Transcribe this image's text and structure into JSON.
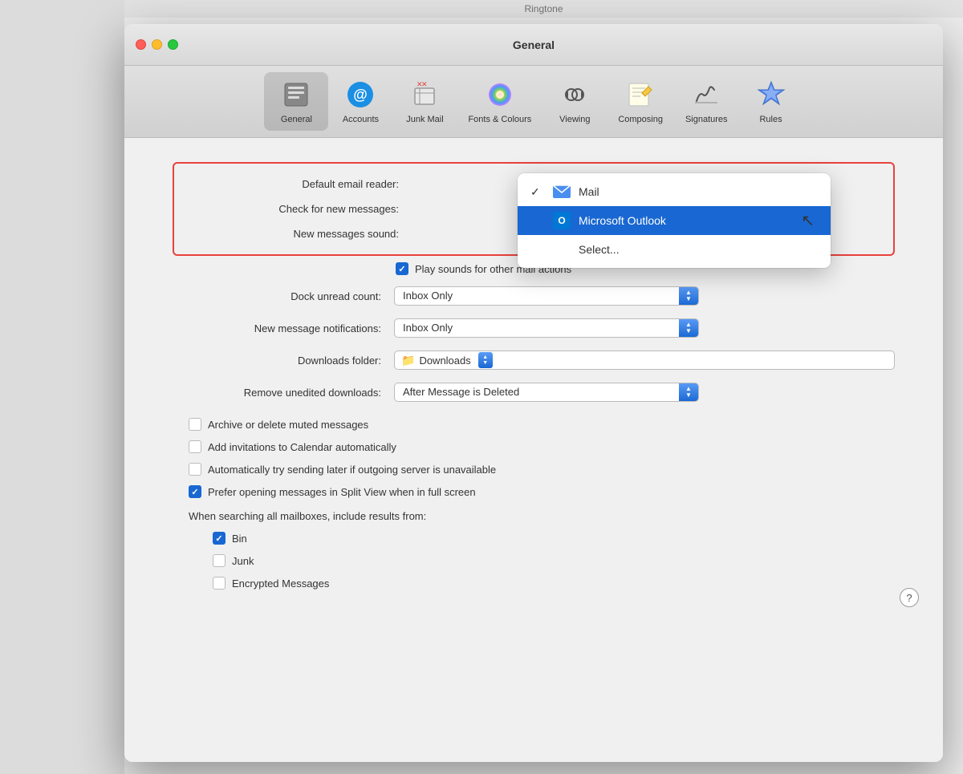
{
  "window": {
    "ringtone_label": "Ringtone",
    "title": "General",
    "traffic_lights": [
      "close",
      "minimize",
      "zoom"
    ]
  },
  "toolbar": {
    "items": [
      {
        "id": "general",
        "label": "General",
        "icon": "⊟",
        "active": true
      },
      {
        "id": "accounts",
        "label": "Accounts",
        "icon": "@",
        "active": false
      },
      {
        "id": "junk-mail",
        "label": "Junk Mail",
        "icon": "🗑",
        "active": false
      },
      {
        "id": "fonts-colours",
        "label": "Fonts & Colours",
        "icon": "🎨",
        "active": false
      },
      {
        "id": "viewing",
        "label": "Viewing",
        "icon": "👓",
        "active": false
      },
      {
        "id": "composing",
        "label": "Composing",
        "icon": "✏️",
        "active": false
      },
      {
        "id": "signatures",
        "label": "Signatures",
        "icon": "✍️",
        "active": false
      },
      {
        "id": "rules",
        "label": "Rules",
        "icon": "💎",
        "active": false
      }
    ]
  },
  "form": {
    "default_email_reader_label": "Default email reader:",
    "check_new_messages_label": "Check for new messages:",
    "new_messages_sound_label": "New messages sound:",
    "play_sounds_label": "Play sounds for other mail actions",
    "dock_unread_label": "Dock unread count:",
    "dock_unread_value": "Inbox Only",
    "new_notifications_label": "New message notifications:",
    "new_notifications_value": "Inbox Only",
    "downloads_folder_label": "Downloads folder:",
    "downloads_folder_value": "Downloads",
    "remove_downloads_label": "Remove unedited downloads:",
    "remove_downloads_value": "After Message is Deleted"
  },
  "checkboxes": [
    {
      "id": "archive-delete",
      "label": "Archive or delete muted messages",
      "checked": false
    },
    {
      "id": "add-invitations",
      "label": "Add invitations to Calendar automatically",
      "checked": false
    },
    {
      "id": "auto-send-later",
      "label": "Automatically try sending later if outgoing server is unavailable",
      "checked": false
    },
    {
      "id": "split-view",
      "label": "Prefer opening messages in Split View when in full screen",
      "checked": true
    }
  ],
  "search_section": {
    "title": "When searching all mailboxes, include results from:",
    "items": [
      {
        "id": "bin",
        "label": "Bin",
        "checked": true
      },
      {
        "id": "junk",
        "label": "Junk",
        "checked": false
      },
      {
        "id": "encrypted",
        "label": "Encrypted Messages",
        "checked": false
      }
    ]
  },
  "dropdown_menu": {
    "items": [
      {
        "id": "mail",
        "label": "Mail",
        "checked": true,
        "selected": false
      },
      {
        "id": "outlook",
        "label": "Microsoft Outlook",
        "checked": false,
        "selected": true
      },
      {
        "id": "select",
        "label": "Select...",
        "checked": false,
        "selected": false
      }
    ]
  },
  "help": {
    "label": "?"
  }
}
